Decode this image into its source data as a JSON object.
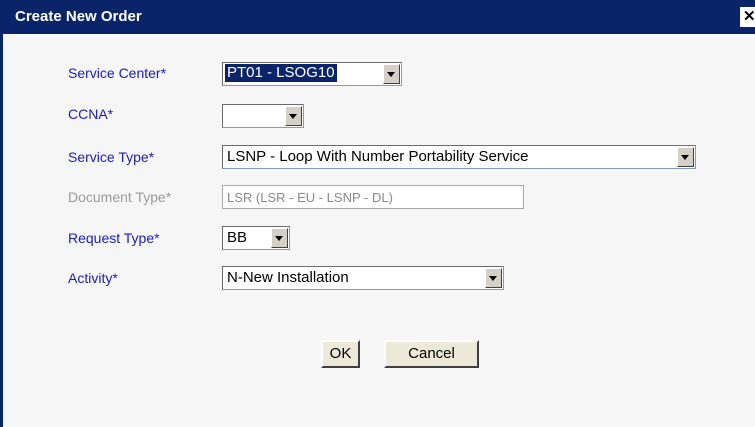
{
  "dialog": {
    "title": "Create New Order",
    "close_glyph": "✕"
  },
  "form": {
    "service_center": {
      "label": "Service Center*",
      "value": "PT01 - LSOG10"
    },
    "ccna": {
      "label": "CCNA*",
      "value": ""
    },
    "service_type": {
      "label": "Service Type*",
      "value": "LSNP - Loop With Number Portability Service"
    },
    "document_type": {
      "label": "Document Type*",
      "value": "LSR (LSR - EU - LSNP - DL)"
    },
    "request_type": {
      "label": "Request Type*",
      "value": "BB"
    },
    "activity": {
      "label": "Activity*",
      "value": "N-New Installation"
    }
  },
  "buttons": {
    "ok": "OK",
    "cancel": "Cancel"
  },
  "colors": {
    "titlebar": "#0a246a",
    "label": "#1a1acc",
    "disabled_label": "#9a9a9a",
    "background": "#f6f6f6"
  }
}
